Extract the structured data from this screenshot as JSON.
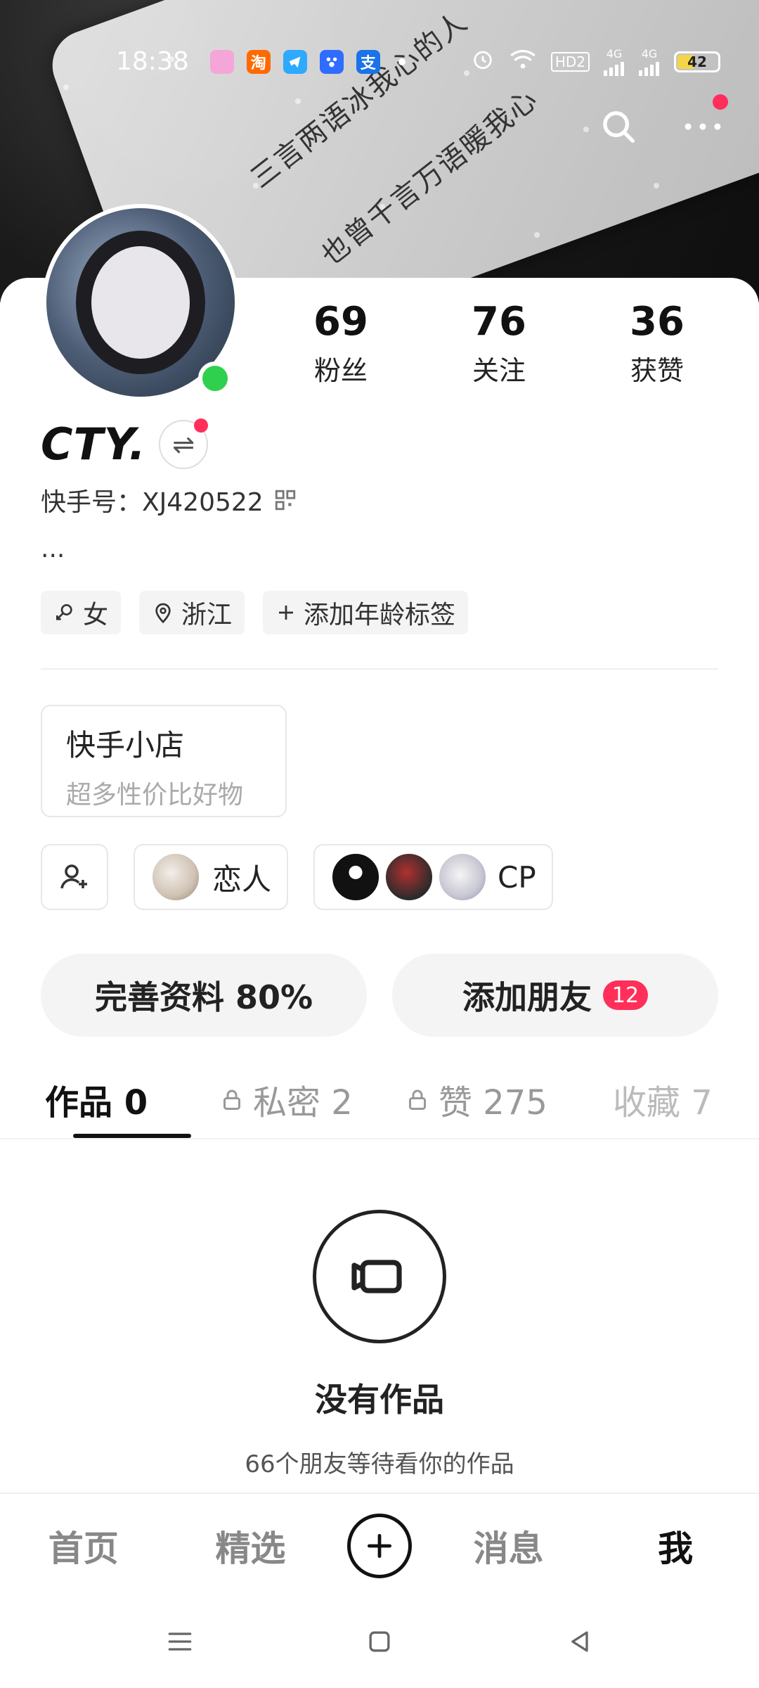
{
  "status_bar": {
    "time": "18:38",
    "app_icons": [
      {
        "label": "",
        "color": "#f5a6d8"
      },
      {
        "label": "淘",
        "color": "#ff6a00"
      },
      {
        "label": "",
        "color": "#2da9ff"
      },
      {
        "label": "",
        "color": "#2f6cff"
      },
      {
        "label": "支",
        "color": "#1a73e8"
      }
    ],
    "network": [
      "HD2",
      "4G",
      "4G"
    ],
    "battery": "42"
  },
  "banner": {
    "line1": "三言两语冰我心的人",
    "line2": "也曾千言万语暖我心"
  },
  "profile": {
    "name": "CTY.",
    "kwai_id": "快手号：XJ420522",
    "bio": "...",
    "tags": [
      {
        "icon": "female-icon",
        "label": "女"
      },
      {
        "icon": "location-pin-icon",
        "label": "浙江"
      },
      {
        "icon": "plus-icon",
        "label": "添加年龄标签"
      }
    ],
    "stats": [
      {
        "num": "69",
        "label": "粉丝"
      },
      {
        "num": "76",
        "label": "关注"
      },
      {
        "num": "36",
        "label": "获赞"
      }
    ]
  },
  "shop": {
    "title": "快手小店",
    "subtitle": "超多性价比好物"
  },
  "relations": {
    "lover_label": "恋人",
    "cp_label": "CP"
  },
  "actions": {
    "complete_profile": "完善资料 80%",
    "add_friends": "添加朋友",
    "add_friends_badge": "12"
  },
  "tabs": [
    {
      "label": "作品 0",
      "locked": false
    },
    {
      "label": "私密 2",
      "locked": true
    },
    {
      "label": "赞 275",
      "locked": true
    },
    {
      "label": "收藏 7",
      "locked": false
    }
  ],
  "empty": {
    "title": "没有作品",
    "subtitle": "66个朋友等待看你的作品"
  },
  "bottom_nav": {
    "home": "首页",
    "featured": "精选",
    "messages": "消息",
    "me": "我"
  }
}
